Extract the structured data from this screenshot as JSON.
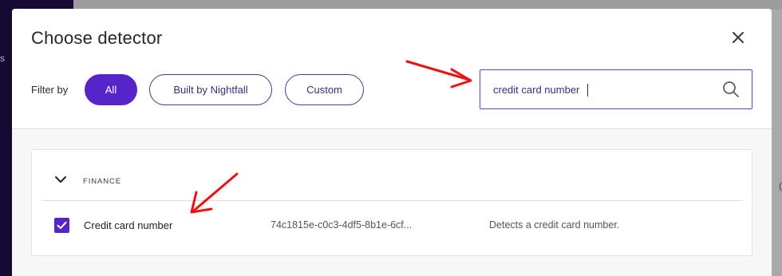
{
  "background": {
    "sidebar_fragment": "s",
    "right_fragment": "("
  },
  "modal": {
    "title": "Choose detector",
    "close_icon": "close-icon"
  },
  "filter": {
    "label": "Filter by",
    "options": [
      {
        "label": "All",
        "active": true
      },
      {
        "label": "Built by Nightfall",
        "active": false
      },
      {
        "label": "Custom",
        "active": false
      }
    ]
  },
  "search": {
    "value": "credit card number",
    "icon": "search-icon"
  },
  "results": {
    "groups": [
      {
        "name": "FINANCE",
        "expanded": true,
        "rows": [
          {
            "checked": true,
            "name": "Credit card number",
            "id": "74c1815e-c0c3-4df5-8b1e-6cf...",
            "description": "Detects a credit card number."
          }
        ]
      }
    ]
  },
  "colors": {
    "accent": "#5624c9",
    "annotation_arrow": "#ee1111"
  }
}
